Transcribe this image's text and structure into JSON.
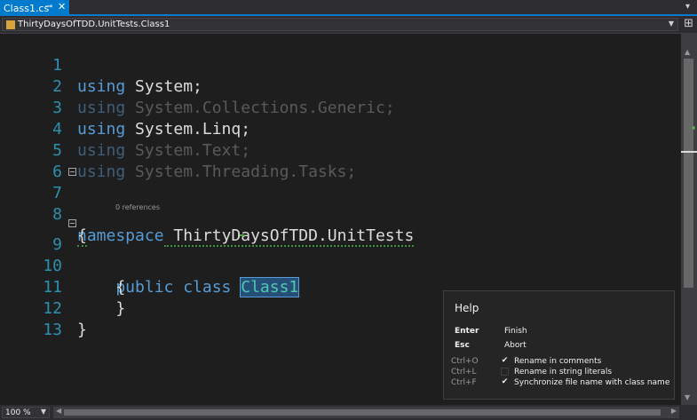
{
  "tab": {
    "title": "Class1.cs",
    "pin_icon": "pin-icon",
    "close_icon": "close-icon",
    "dropdown_icon": "tab-list-dropdown-icon"
  },
  "navbar": {
    "type_icon": "class-icon",
    "type_name": "ThirtyDaysOfTDD.UnitTests.Class1"
  },
  "editor": {
    "code_lens": "0 references",
    "lines": [
      {
        "num": "1"
      },
      {
        "num": "2"
      },
      {
        "num": "3"
      },
      {
        "num": "4"
      },
      {
        "num": "5"
      },
      {
        "num": "6"
      },
      {
        "num": "7"
      },
      {
        "num": "8"
      },
      {
        "num": "9"
      },
      {
        "num": "10"
      },
      {
        "num": "11"
      },
      {
        "num": "12"
      },
      {
        "num": "13"
      }
    ],
    "tokens": {
      "using": "using",
      "system": " System;",
      "collections": " System.Collections.Generic;",
      "linq": " System.Linq;",
      "text": " System.Text;",
      "tasks": " System.Threading.Tasks;",
      "namespace_kw": "namespace",
      "namespace_name": " ThirtyDaysOfTDD.UnitTests",
      "open_brace": "{",
      "close_brace": "}",
      "public_class": "    public class ",
      "class_name": "Class1",
      "inner_open": "    {",
      "inner_close": "    }"
    }
  },
  "zoom": {
    "value": "100 %"
  },
  "help_popup": {
    "title": "Help",
    "keys": [
      {
        "key": "Enter",
        "action": "Finish"
      },
      {
        "key": "Esc",
        "action": "Abort"
      }
    ],
    "options": [
      {
        "shortcut": "Ctrl+O",
        "checked": true,
        "check_glyph": "✔",
        "label": "Rename in comments"
      },
      {
        "shortcut": "Ctrl+L",
        "checked": false,
        "check_glyph": "",
        "label": "Rename in string literals"
      },
      {
        "shortcut": "Ctrl+F",
        "checked": true,
        "check_glyph": "✔",
        "label": "Synchronize file name with class name"
      }
    ]
  },
  "colors": {
    "accent": "#007acc",
    "keyword": "#569cd6",
    "type": "#4ec9b0",
    "line_number": "#2b91af",
    "background": "#1e1e1e"
  }
}
